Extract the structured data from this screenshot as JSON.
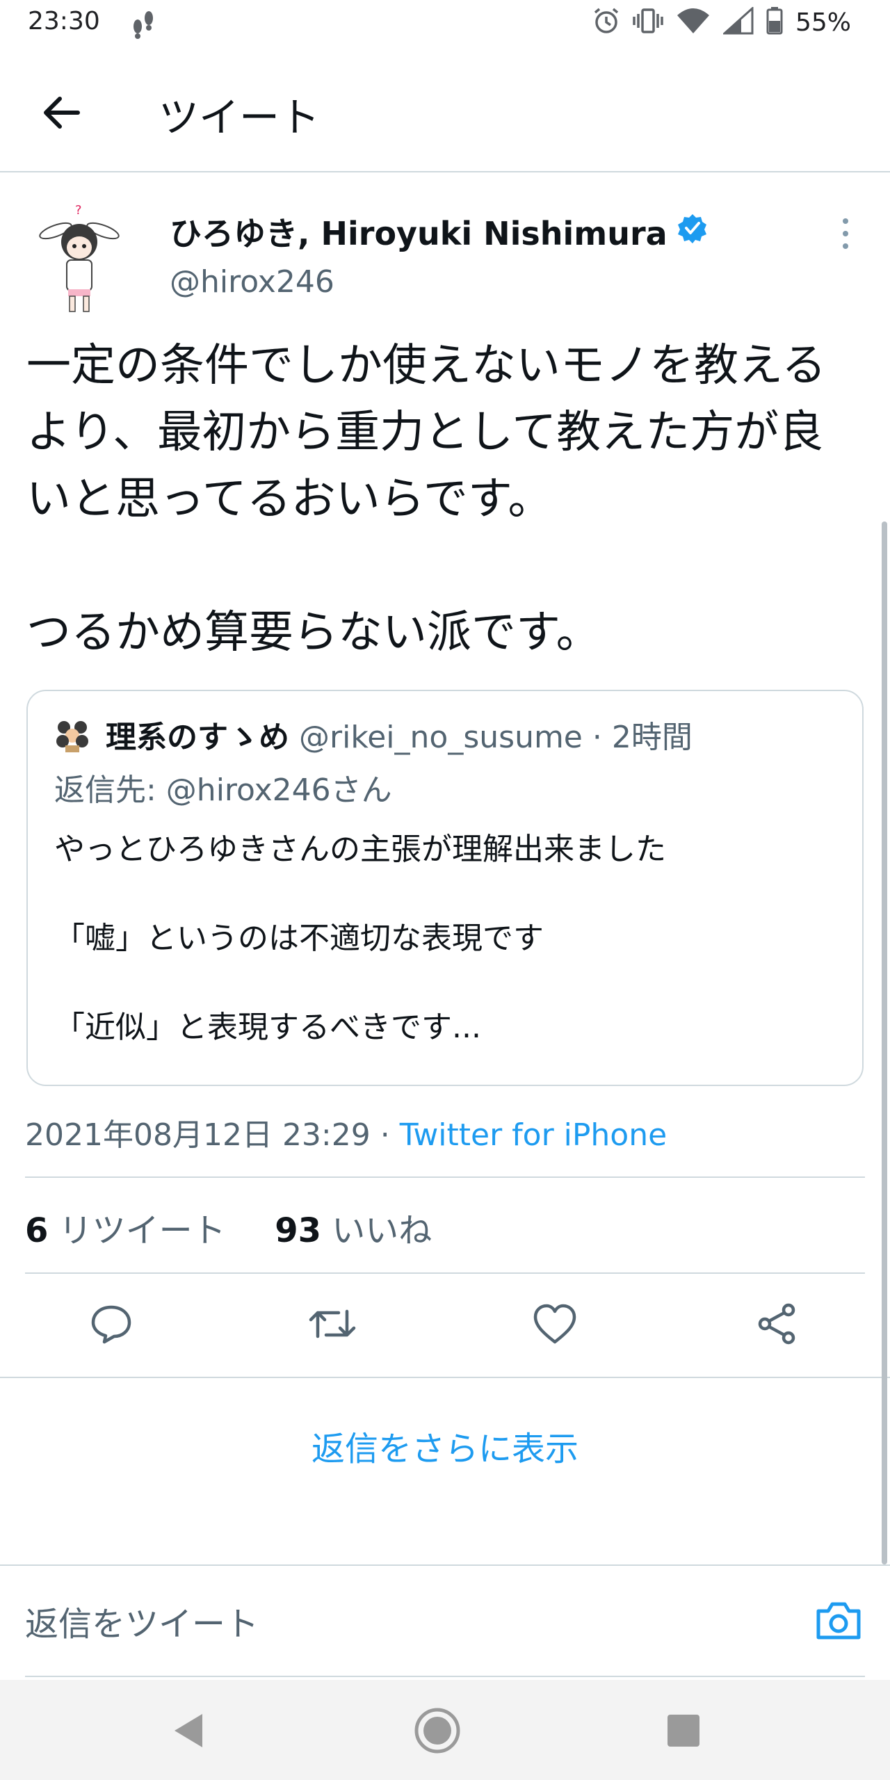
{
  "status_bar": {
    "time": "23:30",
    "battery": "55%"
  },
  "header": {
    "title": "ツイート"
  },
  "tweet": {
    "author_name": "ひろゆき, Hiroyuki Nishimura",
    "author_handle": "@hirox246",
    "text": "一定の条件でしか使えないモノを教えるより、最初から重力として教えた方が良いと思ってるおいらです。\n\nつるかめ算要らない派です。",
    "timestamp": "2021年08月12日 23:29",
    "separator": " · ",
    "source": "Twitter for iPhone",
    "retweets": "6",
    "retweets_label": "リツイート",
    "likes": "93",
    "likes_label": "いいね"
  },
  "quote": {
    "author_name": "理系のすゝめ",
    "author_handle": "@rikei_no_susume",
    "time": " · 2時間",
    "reply_to": "返信先: @hirox246さん",
    "text": "やっとひろゆきさんの主張が理解出来ました\n\n「嘘」というのは不適切な表現です\n\n「近似」と表現するべきです..."
  },
  "more_replies": "返信をさらに表示",
  "composer": {
    "placeholder": "返信をツイート"
  },
  "colors": {
    "accent": "#1d9bf0",
    "secondary": "#536471",
    "divider": "#cfd9de"
  },
  "icons": {
    "back": "arrow-left-icon",
    "verified": "verified-badge-icon",
    "more": "more-vertical-icon",
    "reply": "reply-icon",
    "retweet": "retweet-icon",
    "like": "heart-icon",
    "share": "share-icon",
    "camera": "camera-icon"
  }
}
